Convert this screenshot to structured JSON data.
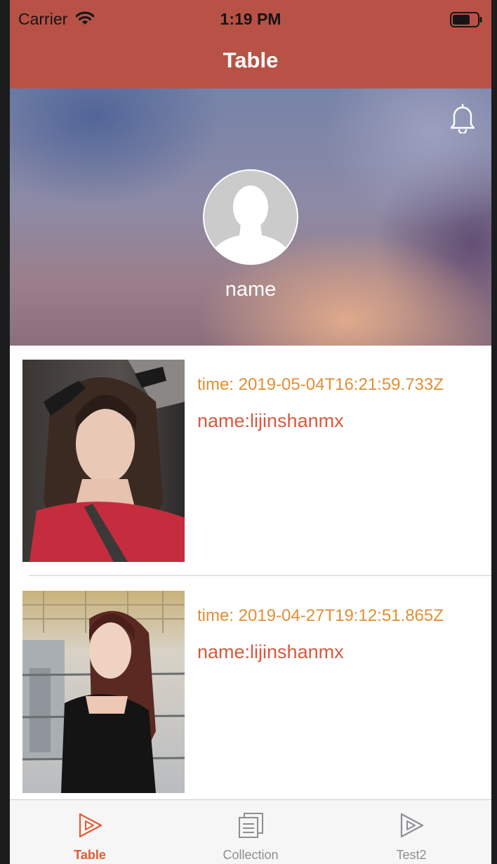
{
  "status_bar": {
    "carrier": "Carrier",
    "time": "1:19 PM"
  },
  "nav": {
    "title": "Table"
  },
  "profile": {
    "name": "name",
    "bell_icon": "bell-icon",
    "avatar_icon": "person-placeholder-icon"
  },
  "list": {
    "items": [
      {
        "time": "time: 2019-05-04T16:21:59.733Z",
        "name": "name:lijinshanmx"
      },
      {
        "time": "time: 2019-04-27T19:12:51.865Z",
        "name": "name:lijinshanmx"
      }
    ]
  },
  "tabs": [
    {
      "label": "Table",
      "icon": "play-outline-icon",
      "active": true
    },
    {
      "label": "Collection",
      "icon": "stacked-docs-icon",
      "active": false
    },
    {
      "label": "Test2",
      "icon": "play-outline-icon",
      "active": false
    }
  ],
  "colors": {
    "nav_bar": "#b85246",
    "accent": "#e4592f",
    "time_text": "#e38e35",
    "name_text": "#d9593e"
  }
}
